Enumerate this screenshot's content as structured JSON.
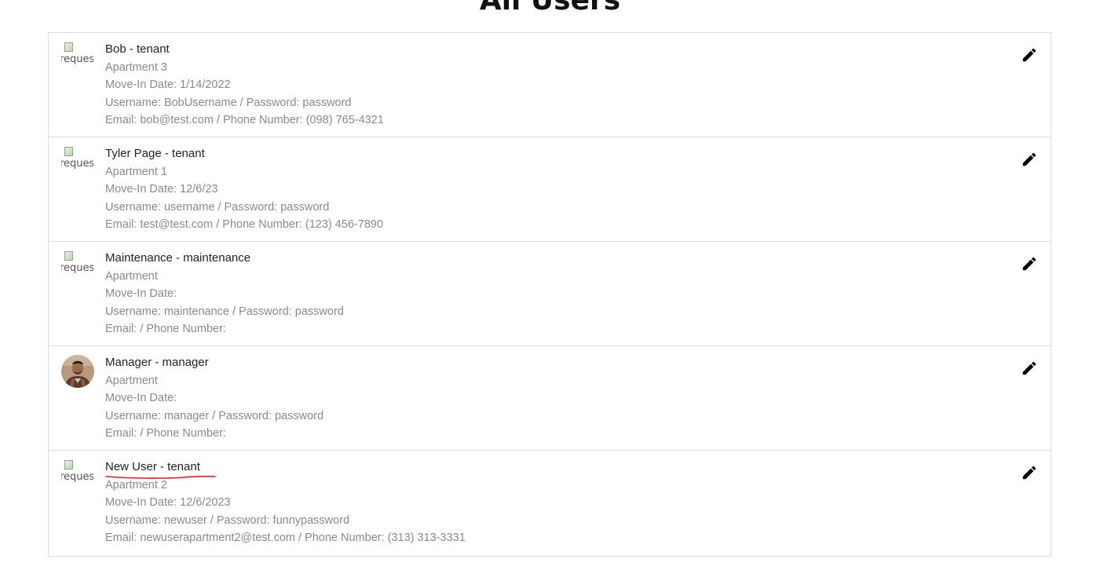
{
  "page": {
    "title": "All Users"
  },
  "users": [
    {
      "name_role": "Bob - tenant",
      "apartment": "Apartment 3",
      "move_in": "Move-In Date: 1/14/2022",
      "credentials": "Username: BobUsername / Password: password",
      "contact": "Email: bob@test.com / Phone Number: (098) 765-4321",
      "avatar_alt": "request"
    },
    {
      "name_role": "Tyler Page - tenant",
      "apartment": "Apartment 1",
      "move_in": "Move-In Date: 12/6/23",
      "credentials": "Username: username / Password: password",
      "contact": "Email: test@test.com / Phone Number: (123) 456-7890",
      "avatar_alt": "request"
    },
    {
      "name_role": "Maintenance - maintenance",
      "apartment": "Apartment",
      "move_in": "Move-In Date:",
      "credentials": "Username: maintenance / Password: password",
      "contact": "Email: / Phone Number:",
      "avatar_alt": "request"
    },
    {
      "name_role": "Manager - manager",
      "apartment": "Apartment",
      "move_in": "Move-In Date:",
      "credentials": "Username: manager / Password: password",
      "contact": "Email: / Phone Number:",
      "avatar_alt": ""
    },
    {
      "name_role": "New User - tenant",
      "apartment": "Apartment 2",
      "move_in": "Move-In Date: 12/6/2023",
      "credentials": "Username: newuser / Password: funnypassword",
      "contact": "Email: newuserapartment2@test.com / Phone Number: (313) 313-3331",
      "avatar_alt": "request"
    }
  ],
  "icons": {
    "edit": "pencil-icon",
    "broken_image": "broken-image-icon",
    "photo": "avatar-photo"
  },
  "colors": {
    "name_text": "#222222",
    "detail_text": "#8a8a8a",
    "border": "#dcdcdc",
    "annotation": "#e02020"
  }
}
